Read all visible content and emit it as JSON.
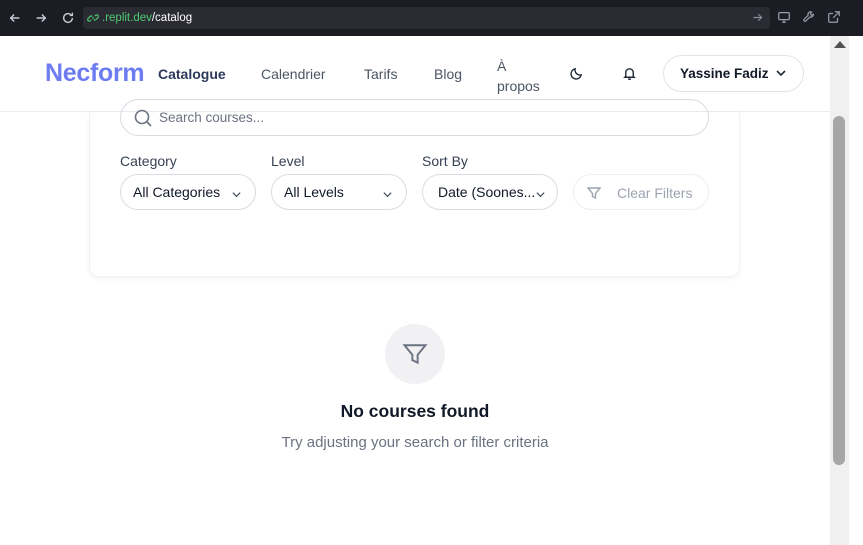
{
  "browser": {
    "url_host": ".replit.dev",
    "url_path": "/catalog"
  },
  "header": {
    "logo": "Necform",
    "nav": [
      "Catalogue",
      "Calendrier",
      "Tarifs",
      "Blog"
    ],
    "nav_apropos_line1": "À",
    "nav_apropos_line2": "propos",
    "user_name": "Yassine Fadiz"
  },
  "filters": {
    "search_placeholder": "Search courses...",
    "category_label": "Category",
    "category_value": "All Categories",
    "level_label": "Level",
    "level_value": "All Levels",
    "sort_label": "Sort By",
    "sort_value": "Date (Soones...",
    "clear_label": "Clear Filters"
  },
  "empty": {
    "title": "No courses found",
    "subtitle": "Try adjusting your search or filter criteria"
  },
  "colors": {
    "brand": "#6d7cf1",
    "browser_bg": "#1c1c24",
    "url_green": "#4ecb71"
  },
  "icons": [
    "back-arrow-icon",
    "forward-arrow-icon",
    "reload-icon",
    "link-icon",
    "go-arrow-icon",
    "monitor-icon",
    "wrench-icon",
    "external-link-icon",
    "moon-icon",
    "bell-icon",
    "chevron-down-icon",
    "search-icon",
    "filter-icon"
  ]
}
